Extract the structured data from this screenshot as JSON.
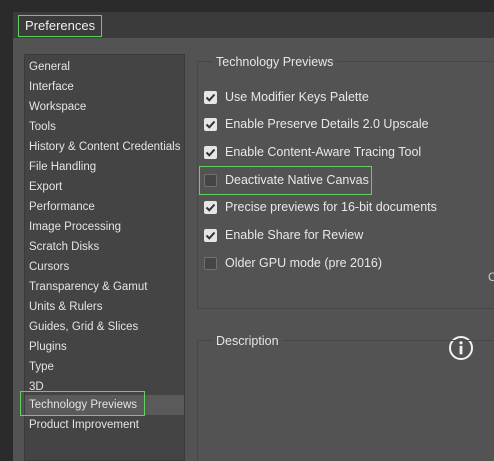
{
  "window": {
    "title": "Preferences"
  },
  "sidebar": {
    "items": [
      {
        "label": "General"
      },
      {
        "label": "Interface"
      },
      {
        "label": "Workspace"
      },
      {
        "label": "Tools"
      },
      {
        "label": "History & Content Credentials"
      },
      {
        "label": "File Handling"
      },
      {
        "label": "Export"
      },
      {
        "label": "Performance"
      },
      {
        "label": "Image Processing"
      },
      {
        "label": "Scratch Disks"
      },
      {
        "label": "Cursors"
      },
      {
        "label": "Transparency & Gamut"
      },
      {
        "label": "Units & Rulers"
      },
      {
        "label": "Guides, Grid & Slices"
      },
      {
        "label": "Plugins"
      },
      {
        "label": "Type"
      },
      {
        "label": "3D"
      },
      {
        "label": "Technology Previews"
      },
      {
        "label": "Product Improvement"
      }
    ],
    "selected": "Technology Previews"
  },
  "tech_previews": {
    "title": "Technology Previews",
    "options": [
      {
        "label": "Use Modifier Keys Palette",
        "checked": true
      },
      {
        "label": "Enable Preserve Details 2.0 Upscale",
        "checked": true
      },
      {
        "label": "Enable Content-Aware Tracing Tool",
        "checked": true
      },
      {
        "label": "Deactivate Native Canvas",
        "checked": false
      },
      {
        "label": "Precise previews for 16-bit documents",
        "checked": true
      },
      {
        "label": "Enable Share for Review",
        "checked": true
      },
      {
        "label": "Older GPU mode (pre 2016)",
        "checked": false
      }
    ],
    "info_cut_text": "C"
  },
  "description": {
    "title": "Description"
  },
  "colors": {
    "highlight": "#5fd35f",
    "background": "#535353",
    "sidebar_bg": "#444444",
    "titlebar_bg": "#3b3b3b"
  }
}
